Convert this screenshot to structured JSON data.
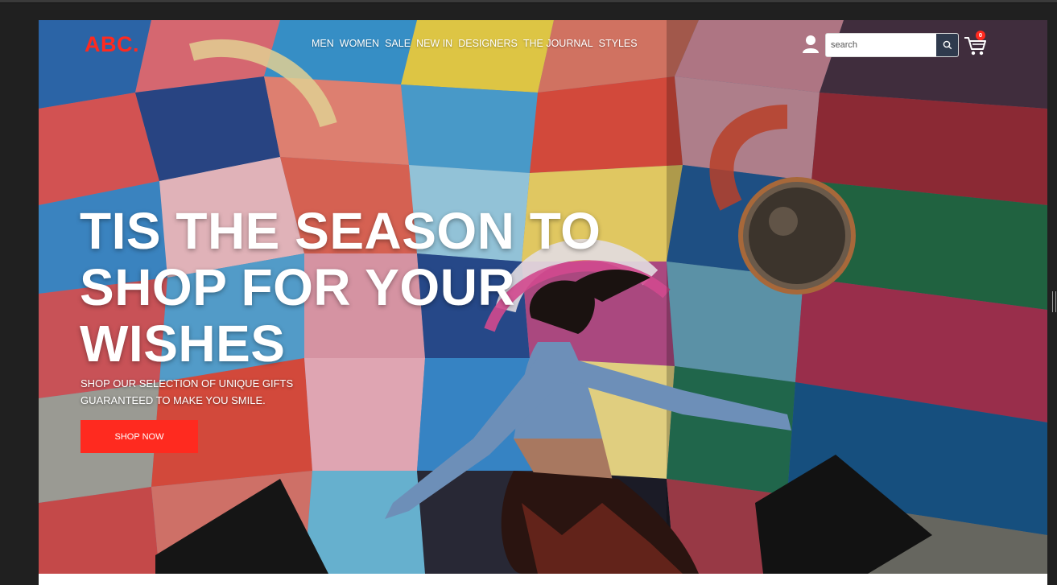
{
  "header": {
    "logo": "ABC.",
    "nav": [
      "MEN",
      "WOMEN",
      "SALE",
      "NEW IN",
      "DESIGNERS",
      "THE JOURNAL",
      "STYLES"
    ],
    "search": {
      "placeholder": "search",
      "value": ""
    },
    "cart": {
      "count": "0"
    }
  },
  "hero": {
    "headline": "TIS THE SEASON TO SHOP FOR YOUR WISHES",
    "subtext": "SHOP OUR SELECTION OF UNIQUE GIFTS GUARANTEED TO MAKE YOU SMILE.",
    "cta_label": "SHOP NOW"
  },
  "colors": {
    "brand": "#ff2a1f",
    "search_button": "#2f3a4d",
    "text_light": "#ffffff",
    "app_background": "#202020"
  },
  "icons": [
    "user-icon",
    "search-icon",
    "cart-icon"
  ]
}
